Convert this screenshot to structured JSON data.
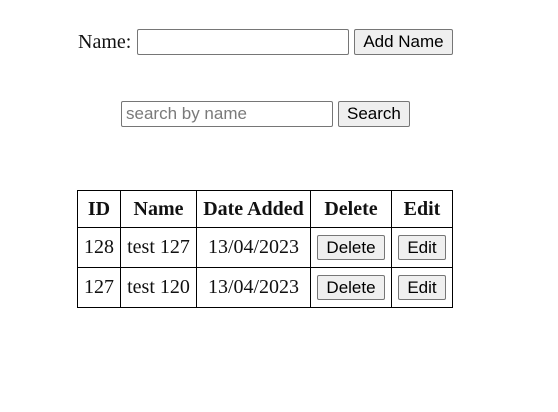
{
  "add_form": {
    "label": "Name:",
    "input_value": "",
    "input_placeholder": "",
    "button_label": "Add Name"
  },
  "search_form": {
    "input_value": "",
    "input_placeholder": "search by name",
    "button_label": "Search"
  },
  "table": {
    "headers": [
      "ID",
      "Name",
      "Date Added",
      "Delete",
      "Edit"
    ],
    "rows": [
      {
        "id": "128",
        "name": "test 127",
        "date_added": "13/04/2023",
        "delete_label": "Delete",
        "edit_label": "Edit"
      },
      {
        "id": "127",
        "name": "test 120",
        "date_added": "13/04/2023",
        "delete_label": "Delete",
        "edit_label": "Edit"
      }
    ]
  }
}
